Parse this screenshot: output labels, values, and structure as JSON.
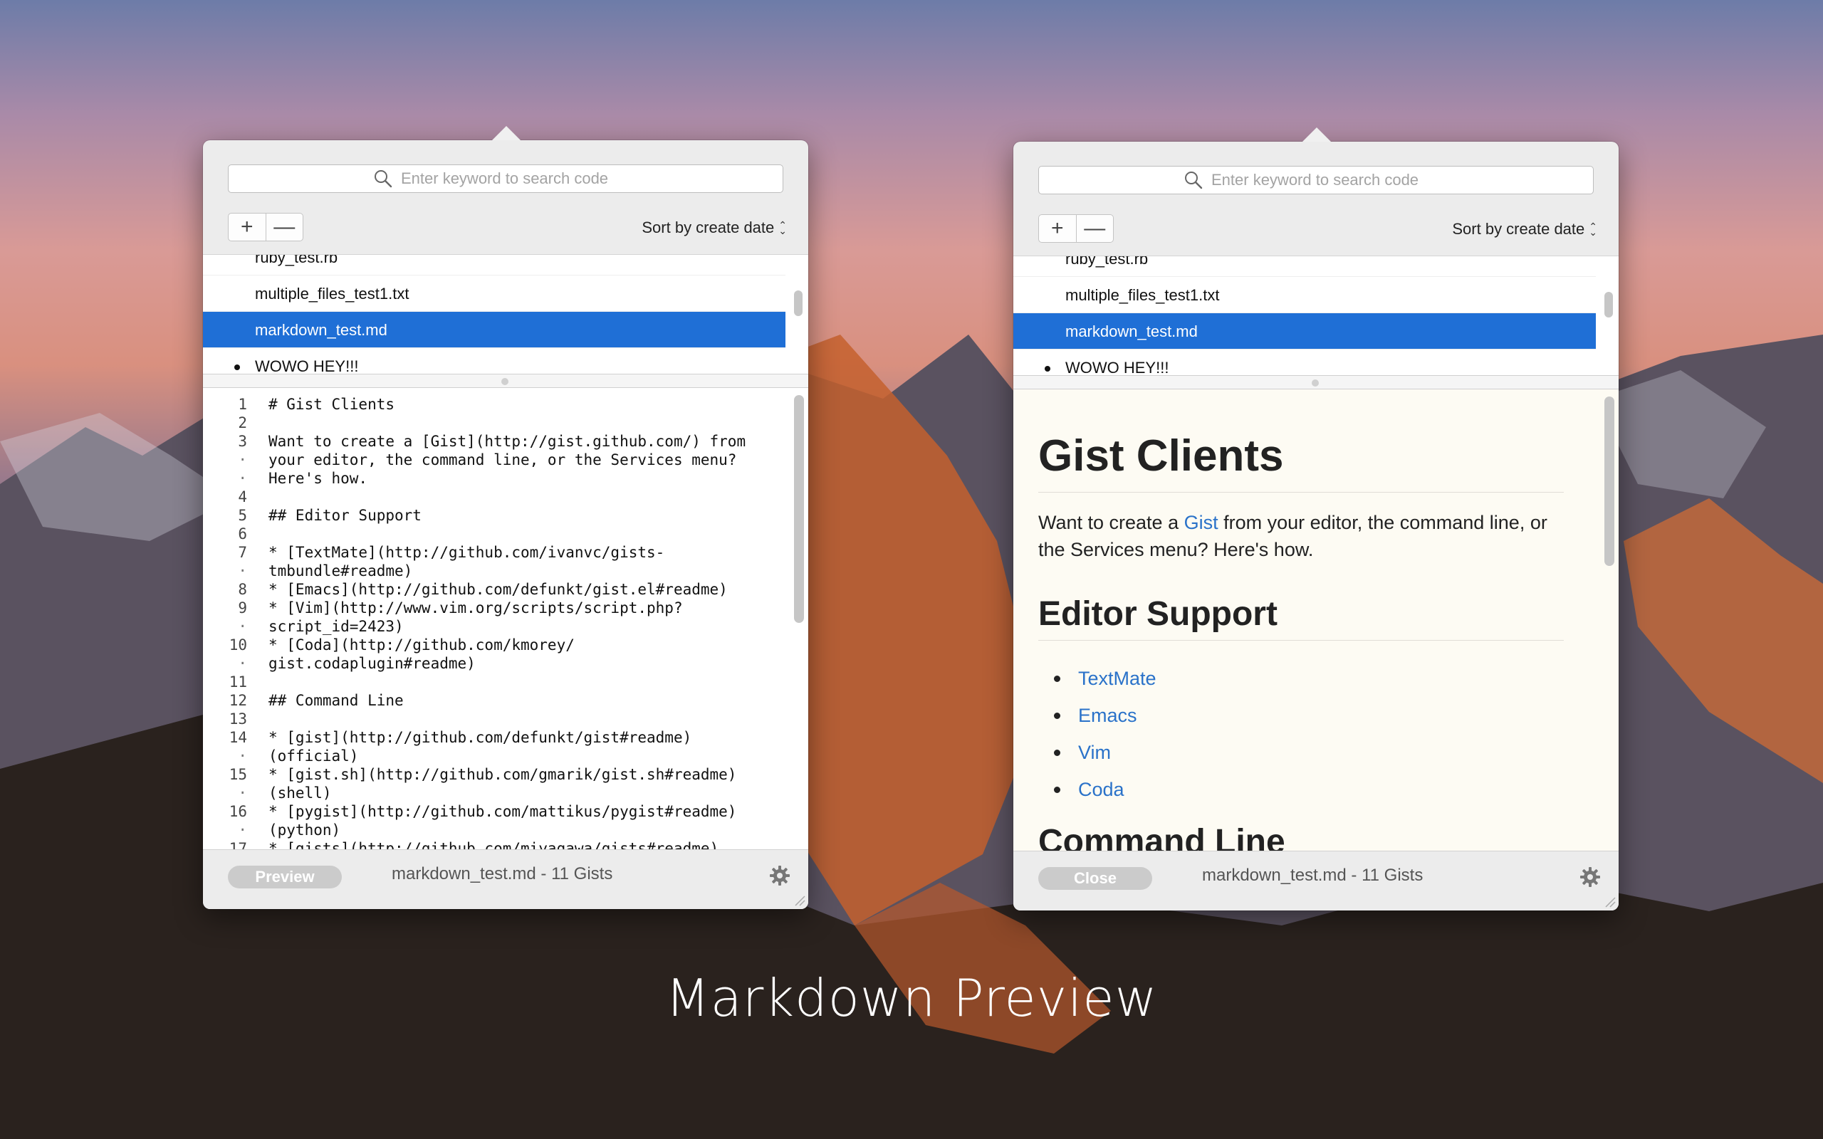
{
  "colors": {
    "selection": "#1f6fd6",
    "link": "#2a72c9",
    "preview_background": "#fdfbf3"
  },
  "windows": [
    {
      "search": {
        "placeholder": "Enter keyword to search code"
      },
      "toolbar": {
        "add_label": "+",
        "remove_label": "—",
        "sort_label": "Sort by create date"
      },
      "list": {
        "items": [
          {
            "label": "ruby_test.rb"
          },
          {
            "label": "multiple_files_test1.txt"
          },
          {
            "label": "markdown_test.md"
          },
          {
            "label": "WOWO HEY!!!"
          }
        ],
        "selected_index": 2
      },
      "editor": {
        "lines": [
          {
            "num": "1",
            "text": "# Gist Clients"
          },
          {
            "num": "2",
            "text": ""
          },
          {
            "num": "3",
            "text": "Want to create a [Gist](http://gist.github.com/) from"
          },
          {
            "num": "·",
            "text": "your editor, the command line, or the Services menu?"
          },
          {
            "num": "·",
            "text": "Here's how."
          },
          {
            "num": "4",
            "text": ""
          },
          {
            "num": "5",
            "text": "## Editor Support"
          },
          {
            "num": "6",
            "text": ""
          },
          {
            "num": "7",
            "text": "* [TextMate](http://github.com/ivanvc/gists-"
          },
          {
            "num": "·",
            "text": "tmbundle#readme)"
          },
          {
            "num": "8",
            "text": "* [Emacs](http://github.com/defunkt/gist.el#readme)"
          },
          {
            "num": "9",
            "text": "* [Vim](http://www.vim.org/scripts/script.php?"
          },
          {
            "num": "·",
            "text": "script_id=2423)"
          },
          {
            "num": "10",
            "text": "* [Coda](http://github.com/kmorey/"
          },
          {
            "num": "·",
            "text": "gist.codaplugin#readme)"
          },
          {
            "num": "11",
            "text": ""
          },
          {
            "num": "12",
            "text": "## Command Line"
          },
          {
            "num": "13",
            "text": ""
          },
          {
            "num": "14",
            "text": "* [gist](http://github.com/defunkt/gist#readme)"
          },
          {
            "num": "·",
            "text": "(official)"
          },
          {
            "num": "15",
            "text": "* [gist.sh](http://github.com/gmarik/gist.sh#readme)"
          },
          {
            "num": "·",
            "text": "(shell)"
          },
          {
            "num": "16",
            "text": "* [pygist](http://github.com/mattikus/pygist#readme)"
          },
          {
            "num": "·",
            "text": "(python)"
          },
          {
            "num": "17",
            "text": "* [gists](http://github.com/miyagawa/gists#readme)"
          }
        ]
      },
      "footer": {
        "button_label": "Preview",
        "status": "markdown_test.md - 11 Gists"
      }
    },
    {
      "search": {
        "placeholder": "Enter keyword to search code"
      },
      "toolbar": {
        "add_label": "+",
        "remove_label": "—",
        "sort_label": "Sort by create date"
      },
      "list": {
        "items": [
          {
            "label": "ruby_test.rb"
          },
          {
            "label": "multiple_files_test1.txt"
          },
          {
            "label": "markdown_test.md"
          },
          {
            "label": "WOWO HEY!!!"
          }
        ],
        "selected_index": 2
      },
      "preview": {
        "h1": "Gist Clients",
        "para_before": "Want to create a ",
        "para_link": "Gist",
        "para_after": " from your editor, the command line, or the Services menu? Here's how.",
        "h2": "Editor Support",
        "links": [
          "TextMate",
          "Emacs",
          "Vim",
          "Coda"
        ],
        "h2b": "Command Line"
      },
      "footer": {
        "button_label": "Close",
        "status": "markdown_test.md - 11 Gists"
      }
    }
  ],
  "caption": "Markdown Preview"
}
